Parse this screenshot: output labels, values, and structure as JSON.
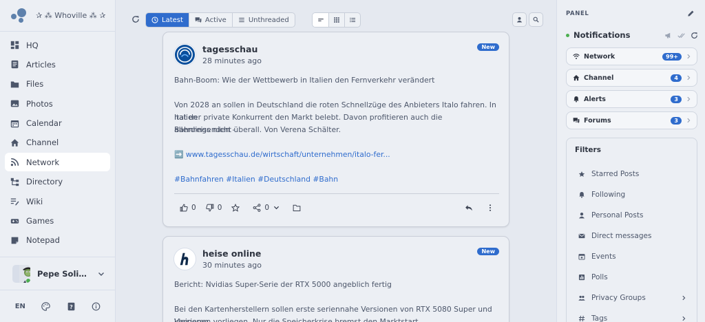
{
  "site": {
    "name": "✰ ⁂ Whoville ⁂ ✰"
  },
  "nav": {
    "items": [
      {
        "label": "HQ",
        "icon": "hq-icon"
      },
      {
        "label": "Articles",
        "icon": "articles-icon"
      },
      {
        "label": "Files",
        "icon": "folder-icon"
      },
      {
        "label": "Photos",
        "icon": "photo-icon"
      },
      {
        "label": "Calendar",
        "icon": "calendar-icon"
      },
      {
        "label": "Channel",
        "icon": "home-icon"
      },
      {
        "label": "Network",
        "icon": "rss-icon"
      },
      {
        "label": "Directory",
        "icon": "directory-icon"
      },
      {
        "label": "Wiki",
        "icon": "wiki-icon"
      },
      {
        "label": "Games",
        "icon": "gamepad-icon"
      },
      {
        "label": "Notepad",
        "icon": "notepad-icon"
      }
    ],
    "active": "Network"
  },
  "user": {
    "name": "Pepe Solidifier",
    "status": "online"
  },
  "footer": {
    "lang": "EN"
  },
  "toolbar": {
    "tabs": [
      {
        "label": "Latest",
        "active": true
      },
      {
        "label": "Active",
        "active": false
      },
      {
        "label": "Unthreaded",
        "active": false
      }
    ]
  },
  "posts": [
    {
      "author": "tagesschau",
      "time": "28 minutes ago",
      "badge": "New",
      "title": "Bahn-Boom: Wie der Wettbewerb in Italien den Fernverkehr verändert",
      "body_l1": "Von 2028 an sollen in Deutschland die roten Schnellzüge des Anbieters Italo fahren. In Italien",
      "body_l2": "hat der private Konkurrent den Markt belebt. Davon profitieren auch die Bahnreisenden -",
      "body_l3": "allerdings nicht überall. Von Verena Schälter.",
      "link": "➡️ www.tagesschau.de/wirtschaft/unternehmen/italo-fer...",
      "tags": "#Bahnfahren #Italien #Deutschland #Bahn",
      "likes": "0",
      "dislikes": "0",
      "shares": "0"
    },
    {
      "author": "heise online",
      "time": "30 minutes ago",
      "badge": "New",
      "title": "Bericht: Nvidias Super-Serie der RTX 5000 angeblich fertig",
      "body_l1": "Bei den Kartenherstellern sollen erste seriennahe Versionen von RTX 5080 Super und kleineren",
      "body_l2": "Versionen vorliegen. Nur die Speicherkrise bremst den Marktstart."
    }
  ],
  "panel": {
    "title": "PANEL",
    "notifications_title": "Notifications",
    "rows": [
      {
        "label": "Network",
        "count": "99+"
      },
      {
        "label": "Channel",
        "count": "4"
      },
      {
        "label": "Alerts",
        "count": "3"
      },
      {
        "label": "Forums",
        "count": "3"
      }
    ],
    "filters_title": "Filters",
    "filters": [
      "Starred Posts",
      "Following",
      "Personal Posts",
      "Direct messages",
      "Events",
      "Polls",
      "Privacy Groups",
      "Tags"
    ]
  },
  "colors": {
    "accent": "#2f6ccd",
    "online": "#4caf50",
    "background": "#e5e9f0"
  }
}
